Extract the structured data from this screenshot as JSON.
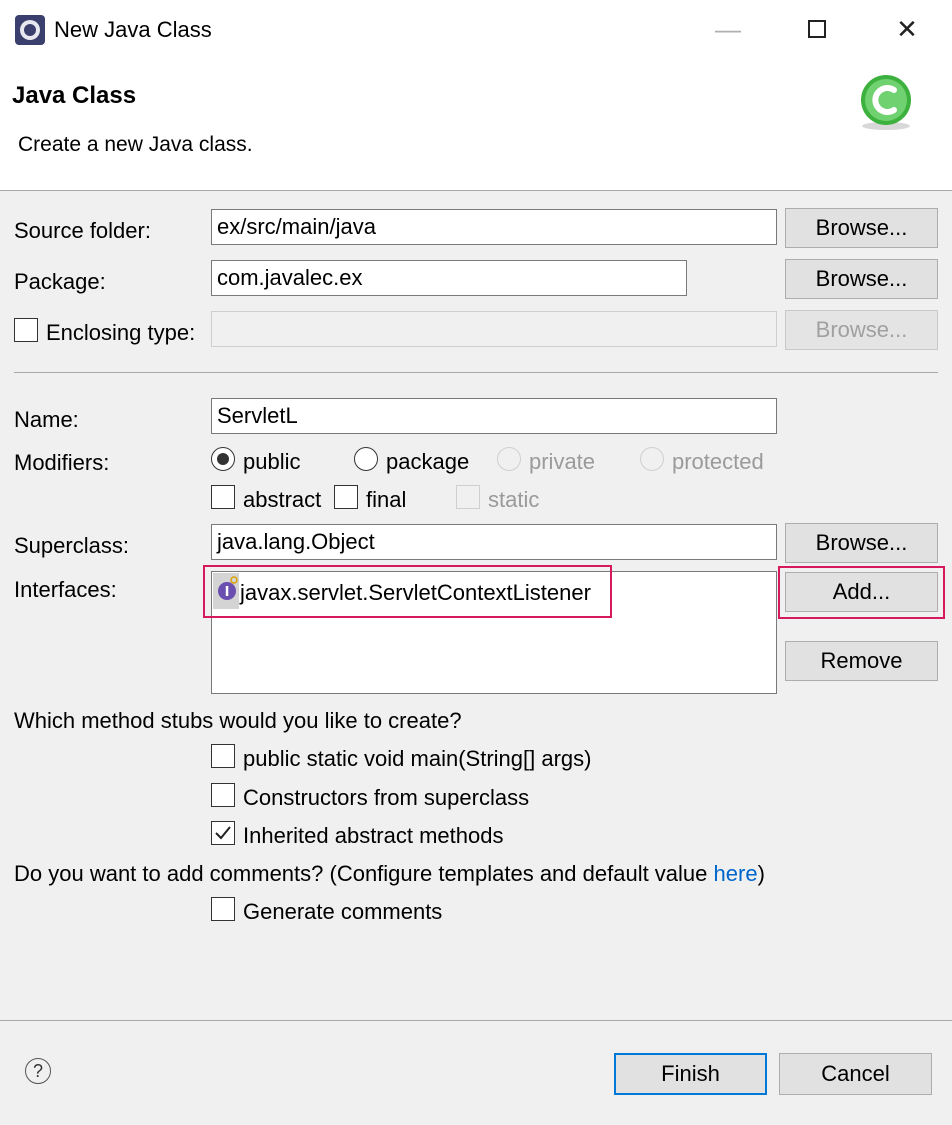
{
  "window": {
    "title": "New Java Class",
    "minimize_glyph": "—",
    "maximize_glyph": "☐",
    "close_glyph": "✕"
  },
  "header": {
    "title": "Java Class",
    "description": "Create a new Java class."
  },
  "form": {
    "source_folder": {
      "label": "Source folder:",
      "value": "ex/src/main/java",
      "browse": "Browse..."
    },
    "package": {
      "label": "Package:",
      "value": "com.javalec.ex",
      "browse": "Browse..."
    },
    "enclosing_type": {
      "label": "Enclosing type:",
      "value": "",
      "checked": false,
      "browse": "Browse..."
    },
    "name": {
      "label": "Name:",
      "value": "ServletL"
    },
    "modifiers": {
      "label": "Modifiers:",
      "radios": [
        {
          "label": "public",
          "selected": true,
          "enabled": true
        },
        {
          "label": "package",
          "selected": false,
          "enabled": true
        },
        {
          "label": "private",
          "selected": false,
          "enabled": false
        },
        {
          "label": "protected",
          "selected": false,
          "enabled": false
        }
      ],
      "checks": [
        {
          "label": "abstract",
          "checked": false,
          "enabled": true
        },
        {
          "label": "final",
          "checked": false,
          "enabled": true
        },
        {
          "label": "static",
          "checked": false,
          "enabled": false
        }
      ]
    },
    "superclass": {
      "label": "Superclass:",
      "value": "java.lang.Object",
      "browse": "Browse..."
    },
    "interfaces": {
      "label": "Interfaces:",
      "items": [
        "javax.servlet.ServletContextListener"
      ],
      "add": "Add...",
      "remove": "Remove"
    },
    "stubs": {
      "question": "Which method stubs would you like to create?",
      "options": [
        {
          "label": "public static void main(String[] args)",
          "checked": false
        },
        {
          "label": "Constructors from superclass",
          "checked": false
        },
        {
          "label": "Inherited abstract methods",
          "checked": true
        }
      ]
    },
    "comments": {
      "question_prefix": "Do you want to add comments? (Configure templates and default value ",
      "link": "here",
      "question_suffix": ")",
      "option": {
        "label": "Generate comments",
        "checked": false
      }
    }
  },
  "footer": {
    "help_glyph": "?",
    "finish": "Finish",
    "cancel": "Cancel"
  },
  "colors": {
    "highlight": "#d6185d",
    "link": "#0066cc",
    "primary_border": "#0078d7"
  }
}
